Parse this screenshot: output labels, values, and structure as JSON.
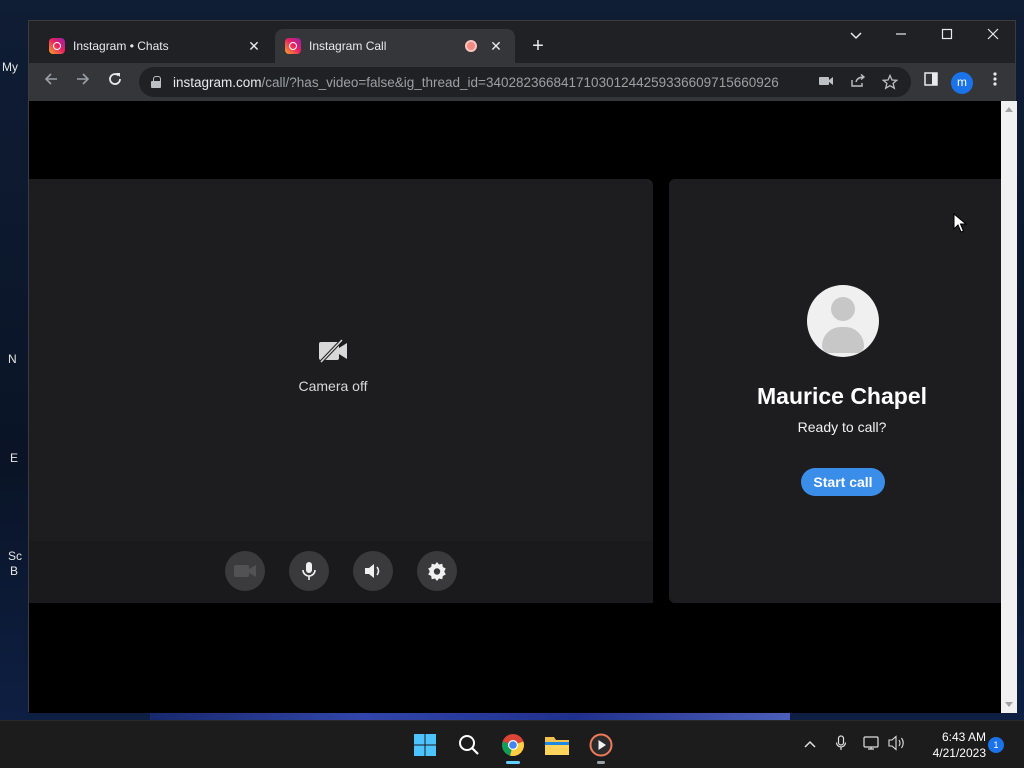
{
  "tabs": [
    {
      "title": "Instagram • Chats",
      "active": false
    },
    {
      "title": "Instagram Call",
      "active": true,
      "recording": true
    }
  ],
  "address_bar": {
    "host": "instagram.com",
    "path": "/call/?has_video=false&ig_thread_id=340282366841710301244259336609715660926"
  },
  "profile_initial": "m",
  "self_view": {
    "camera_status": "Camera off"
  },
  "call_card": {
    "callee_name": "Maurice Chapel",
    "prompt": "Ready to call?",
    "start_button": "Start call"
  },
  "desktop": {
    "labels": [
      "My",
      "N",
      "E",
      "Sc",
      "B"
    ]
  },
  "taskbar": {
    "time": "6:43 AM",
    "date": "4/21/2023",
    "notification_count": "1"
  },
  "colors": {
    "accent_blue": "#3a8de8",
    "window_bg": "#202124",
    "panel_bg": "#1d1d1f"
  }
}
